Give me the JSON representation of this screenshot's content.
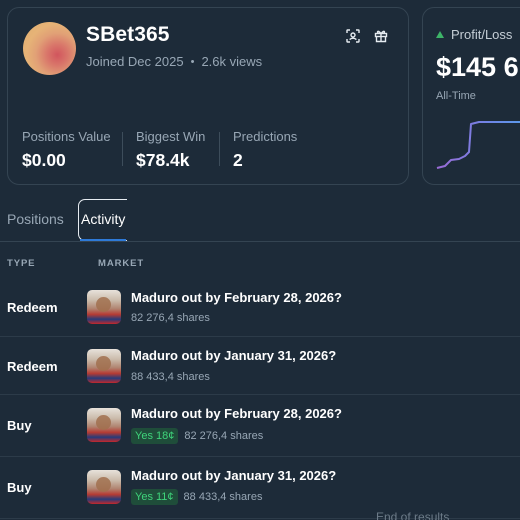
{
  "profile": {
    "username": "SBet365",
    "joined": "Joined Dec 2025",
    "views": "2.6k views",
    "separator": "•",
    "stats": [
      {
        "label": "Positions Value",
        "value": "$0.00"
      },
      {
        "label": "Biggest Win",
        "value": "$78.4k"
      },
      {
        "label": "Predictions",
        "value": "2"
      }
    ],
    "icons": [
      "scan-icon",
      "gift-icon"
    ]
  },
  "pnl": {
    "label": "Profit/Loss",
    "value": "$145 6",
    "range": "All-Time",
    "colors": {
      "up": "#3db468",
      "line_start": "#9b6bd6",
      "line_end": "#4fa9ee"
    }
  },
  "tabs": [
    {
      "label": "Positions",
      "active": false
    },
    {
      "label": "Activity",
      "active": true
    }
  ],
  "table": {
    "columns": [
      "TYPE",
      "MARKET"
    ],
    "rows": [
      {
        "type": "Redeem",
        "title": "Maduro out by February 28, 2026?",
        "badge": "",
        "shares": "82 276,4 shares"
      },
      {
        "type": "Redeem",
        "title": "Maduro out by January 31, 2026?",
        "badge": "",
        "shares": "88 433,4 shares"
      },
      {
        "type": "Buy",
        "title": "Maduro out by February 28, 2026?",
        "badge": "Yes 18¢",
        "shares": "82 276,4 shares"
      },
      {
        "type": "Buy",
        "title": "Maduro out by January 31, 2026?",
        "badge": "Yes 11¢",
        "shares": "88 433,4 shares"
      }
    ],
    "end_text": "End of results"
  },
  "colors": {
    "background": "#1d2b39",
    "border": "#344452",
    "muted_text": "#98a7b5",
    "accent": "#2e7ad8",
    "badge_bg": "#1f4d3a",
    "badge_text": "#3fd47b"
  }
}
